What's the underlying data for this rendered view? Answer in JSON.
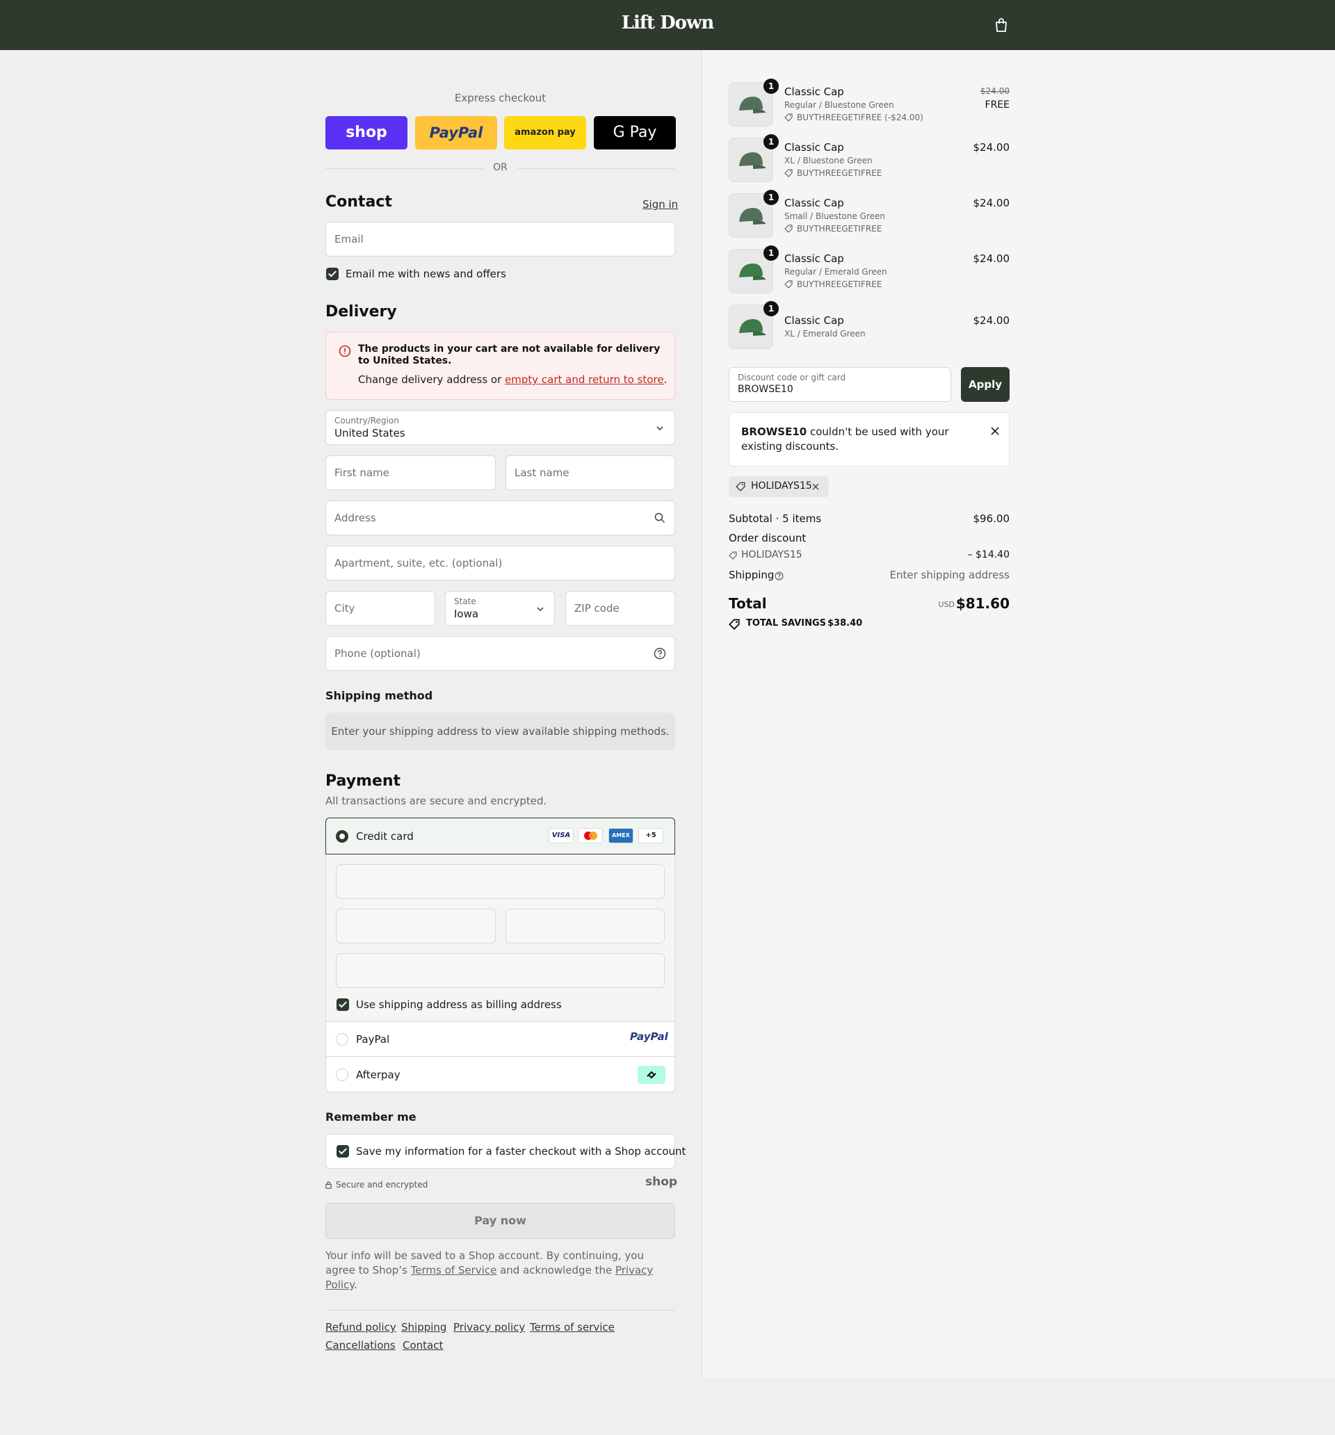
{
  "header": {
    "logo": "Lift Down",
    "cart_icon": "shopping-bag-icon"
  },
  "express": {
    "title": "Express checkout",
    "buttons": [
      "shop",
      "PayPal",
      "amazon pay",
      "G Pay"
    ],
    "or": "OR"
  },
  "contact": {
    "title": "Contact",
    "sign_in": "Sign in",
    "email_placeholder": "Email",
    "news_label": "Email me with news and offers"
  },
  "delivery": {
    "title": "Delivery",
    "error_title": "The products in your cart are not available for delivery to United States.",
    "error_prefix": "Change delivery address or ",
    "error_link": "empty cart and return to store",
    "error_suffix": ".",
    "country_label": "Country/Region",
    "country_value": "United States",
    "first_name": "First name",
    "last_name": "Last name",
    "address": "Address",
    "apartment": "Apartment, suite, etc. (optional)",
    "city": "City",
    "state_label": "State",
    "state_value": "Iowa",
    "zip": "ZIP code",
    "phone": "Phone (optional)"
  },
  "shipping_method": {
    "title": "Shipping method",
    "message": "Enter your shipping address to view available shipping methods."
  },
  "payment": {
    "title": "Payment",
    "subtitle": "All transactions are secure and encrypted.",
    "credit_card": "Credit card",
    "card_badges": [
      "VISA",
      "MC",
      "AMEX",
      "+5"
    ],
    "billing_label": "Use shipping address as billing address",
    "paypal": "PayPal",
    "paypal_logo": "PayPal",
    "afterpay": "Afterpay"
  },
  "remember": {
    "title": "Remember me",
    "save_label": "Save my information for a faster checkout with a Shop account",
    "secure": "Secure and encrypted",
    "shop_logo": "shop"
  },
  "pay_now": "Pay now",
  "legal": {
    "p1": "Your info will be saved to a Shop account. By continuing, you agree to Shop’s ",
    "tos": "Terms of Service",
    "p2": " and acknowledge the ",
    "privacy": "Privacy Policy",
    "p3": "."
  },
  "footer_links": [
    "Refund policy",
    "Shipping",
    "Privacy policy",
    "Terms of service",
    "Cancellations",
    "Contact"
  ],
  "cart": {
    "items": [
      {
        "qty": "1",
        "name": "Classic Cap",
        "variant": "Regular / Bluestone Green",
        "discount": "BUYTHREEGETIFREE (-$24.00)",
        "original_price": "$24.00",
        "price": "FREE"
      },
      {
        "qty": "1",
        "name": "Classic Cap",
        "variant": "XL / Bluestone Green",
        "discount": "BUYTHREEGETIFREE",
        "price": "$24.00"
      },
      {
        "qty": "1",
        "name": "Classic Cap",
        "variant": "Small / Bluestone Green",
        "discount": "BUYTHREEGETIFREE",
        "price": "$24.00"
      },
      {
        "qty": "1",
        "name": "Classic Cap",
        "variant": "Regular / Emerald Green",
        "discount": "BUYTHREEGETIFREE",
        "price": "$24.00"
      },
      {
        "qty": "1",
        "name": "Classic Cap",
        "variant": "XL / Emerald Green",
        "price": "$24.00"
      }
    ],
    "discount_label": "Discount code or gift card",
    "discount_value": "BROWSE10",
    "apply": "Apply",
    "notice_code": "BROWSE10",
    "notice_text": " couldn't be used with your existing discounts.",
    "applied_tag": "HOLIDAYS15",
    "subtotal_label": "Subtotal · 5 items",
    "subtotal_value": "$96.00",
    "order_discount_label": "Order discount",
    "order_discount_code": "HOLIDAYS15",
    "order_discount_value": "– $14.40",
    "shipping_label": "Shipping",
    "shipping_value": "Enter shipping address",
    "total_label": "Total",
    "currency": "USD",
    "total_value": "$81.60",
    "savings_label": "TOTAL SAVINGS",
    "savings_value": "$38.40"
  },
  "colors": {
    "brand_dark": "#2d3a2d",
    "shop_purple": "#5a31f4",
    "paypal_yellow": "#ffc439",
    "amazon_yellow": "#ffd814",
    "error_red": "#c4291c"
  }
}
